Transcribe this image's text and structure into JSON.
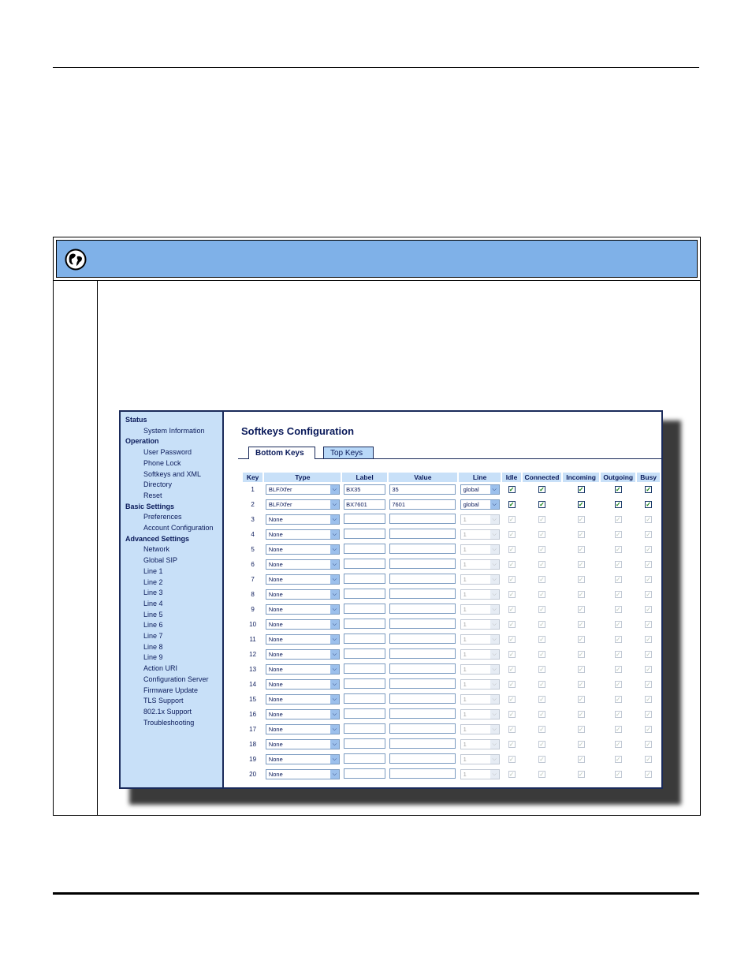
{
  "sidebar": {
    "sections": [
      {
        "title": "Status",
        "items": [
          "System Information"
        ]
      },
      {
        "title": "Operation",
        "items": [
          "User Password",
          "Phone Lock",
          "Softkeys and XML",
          "Directory",
          "Reset"
        ]
      },
      {
        "title": "Basic Settings",
        "items": [
          "Preferences",
          "Account Configuration"
        ]
      },
      {
        "title": "Advanced Settings",
        "items": [
          "Network",
          "Global SIP",
          "Line 1",
          "Line 2",
          "Line 3",
          "Line 4",
          "Line 5",
          "Line 6",
          "Line 7",
          "Line 8",
          "Line 9",
          "Action URI",
          "Configuration Server",
          "Firmware Update",
          "TLS Support",
          "802.1x Support",
          "Troubleshooting"
        ]
      }
    ]
  },
  "main": {
    "title": "Softkeys Configuration",
    "tabs": [
      "Bottom Keys",
      "Top Keys"
    ],
    "columns": [
      "Key",
      "Type",
      "Label",
      "Value",
      "Line",
      "Idle",
      "Connected",
      "Incoming",
      "Outgoing",
      "Busy"
    ],
    "rows": [
      {
        "key": "1",
        "type": "BLF/Xfer",
        "label": "BX35",
        "value": "35",
        "line": "global",
        "enabled": true
      },
      {
        "key": "2",
        "type": "BLF/Xfer",
        "label": "BX7601",
        "value": "7601",
        "line": "global",
        "enabled": true
      },
      {
        "key": "3",
        "type": "None",
        "label": "",
        "value": "",
        "line": "1",
        "enabled": false
      },
      {
        "key": "4",
        "type": "None",
        "label": "",
        "value": "",
        "line": "1",
        "enabled": false
      },
      {
        "key": "5",
        "type": "None",
        "label": "",
        "value": "",
        "line": "1",
        "enabled": false
      },
      {
        "key": "6",
        "type": "None",
        "label": "",
        "value": "",
        "line": "1",
        "enabled": false
      },
      {
        "key": "7",
        "type": "None",
        "label": "",
        "value": "",
        "line": "1",
        "enabled": false
      },
      {
        "key": "8",
        "type": "None",
        "label": "",
        "value": "",
        "line": "1",
        "enabled": false
      },
      {
        "key": "9",
        "type": "None",
        "label": "",
        "value": "",
        "line": "1",
        "enabled": false
      },
      {
        "key": "10",
        "type": "None",
        "label": "",
        "value": "",
        "line": "1",
        "enabled": false
      },
      {
        "key": "11",
        "type": "None",
        "label": "",
        "value": "",
        "line": "1",
        "enabled": false
      },
      {
        "key": "12",
        "type": "None",
        "label": "",
        "value": "",
        "line": "1",
        "enabled": false
      },
      {
        "key": "13",
        "type": "None",
        "label": "",
        "value": "",
        "line": "1",
        "enabled": false
      },
      {
        "key": "14",
        "type": "None",
        "label": "",
        "value": "",
        "line": "1",
        "enabled": false
      },
      {
        "key": "15",
        "type": "None",
        "label": "",
        "value": "",
        "line": "1",
        "enabled": false
      },
      {
        "key": "16",
        "type": "None",
        "label": "",
        "value": "",
        "line": "1",
        "enabled": false
      },
      {
        "key": "17",
        "type": "None",
        "label": "",
        "value": "",
        "line": "1",
        "enabled": false
      },
      {
        "key": "18",
        "type": "None",
        "label": "",
        "value": "",
        "line": "1",
        "enabled": false
      },
      {
        "key": "19",
        "type": "None",
        "label": "",
        "value": "",
        "line": "1",
        "enabled": false
      },
      {
        "key": "20",
        "type": "None",
        "label": "",
        "value": "",
        "line": "1",
        "enabled": false
      }
    ]
  },
  "icons": {
    "header": "globe-icon",
    "select_arrow": "chevron-down-icon",
    "check": "checkmark-icon"
  },
  "colors": {
    "header_bar": "#7fb1e8",
    "sidebar_bg": "#c8e0f8",
    "nav_text": "#0a1a5a"
  }
}
